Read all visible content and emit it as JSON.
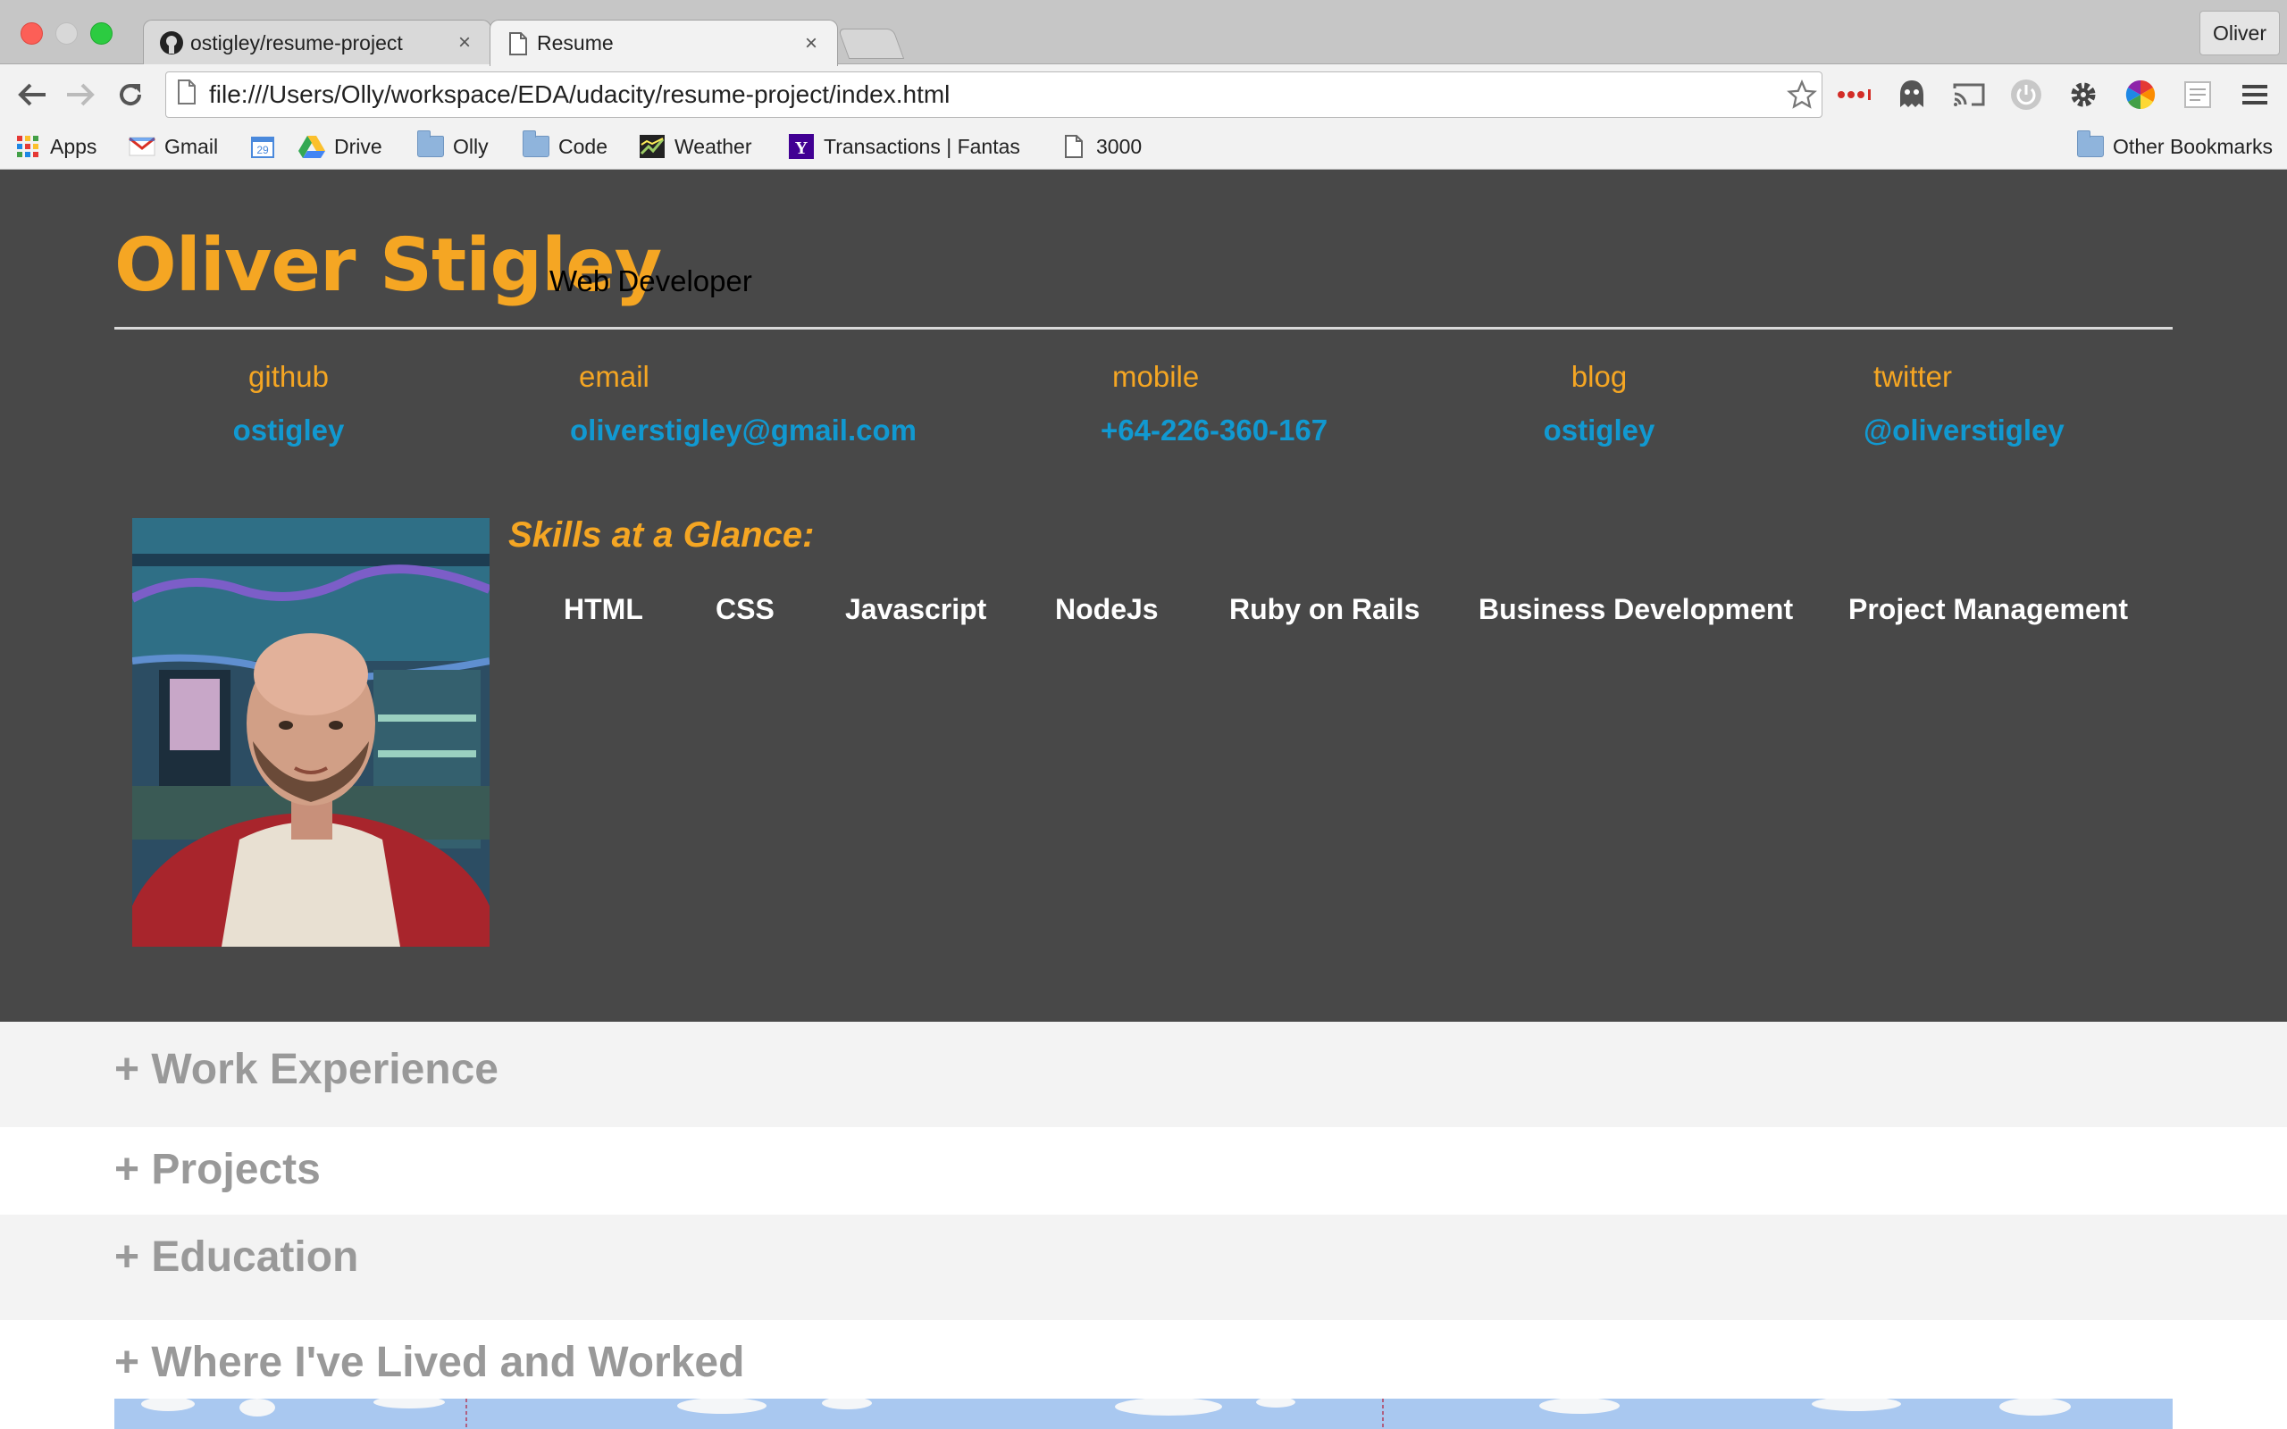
{
  "browser": {
    "tabs": [
      {
        "title": "ostigley/resume-project",
        "close": "×",
        "icon": "github-icon"
      },
      {
        "title": "Resume",
        "close": "×",
        "icon": "page-icon"
      }
    ],
    "profile_name": "Oliver",
    "url": "file:///Users/Olly/workspace/EDA/udacity/resume-project/index.html",
    "bookmarks": [
      {
        "label": "Apps",
        "icon": "apps-grid-icon"
      },
      {
        "label": "Gmail",
        "icon": "gmail-icon"
      },
      {
        "label": "",
        "icon": "calendar-icon",
        "badge": "29"
      },
      {
        "label": "Drive",
        "icon": "drive-icon"
      },
      {
        "label": "Olly",
        "icon": "folder-icon"
      },
      {
        "label": "Code",
        "icon": "folder-icon"
      },
      {
        "label": "Weather",
        "icon": "weather-icon"
      },
      {
        "label": "Transactions | Fantas",
        "icon": "yahoo-icon"
      },
      {
        "label": "3000",
        "icon": "page-icon"
      }
    ],
    "other_bookmarks": "Other Bookmarks"
  },
  "resume": {
    "name": "Oliver Stigley",
    "role": "Web Developer",
    "contacts": [
      {
        "label": "github",
        "value": "ostigley"
      },
      {
        "label": "email",
        "value": "oliverstigley@gmail.com"
      },
      {
        "label": "mobile",
        "value": "+64-226-360-167"
      },
      {
        "label": "blog",
        "value": "ostigley"
      },
      {
        "label": "twitter",
        "value": "@oliverstigley"
      }
    ],
    "skills_title": "Skills at a Glance:",
    "skills": [
      "HTML",
      "CSS",
      "Javascript",
      "NodeJs",
      "Ruby on Rails",
      "Business Development",
      "Project Management"
    ],
    "sections": {
      "work": "+ Work Experience",
      "projects": "+ Projects",
      "education": "+ Education",
      "map": "+ Where I've Lived and Worked"
    }
  },
  "colors": {
    "accent_orange": "#f5a623",
    "link_blue": "#1199d1",
    "header_bg": "#484848"
  }
}
